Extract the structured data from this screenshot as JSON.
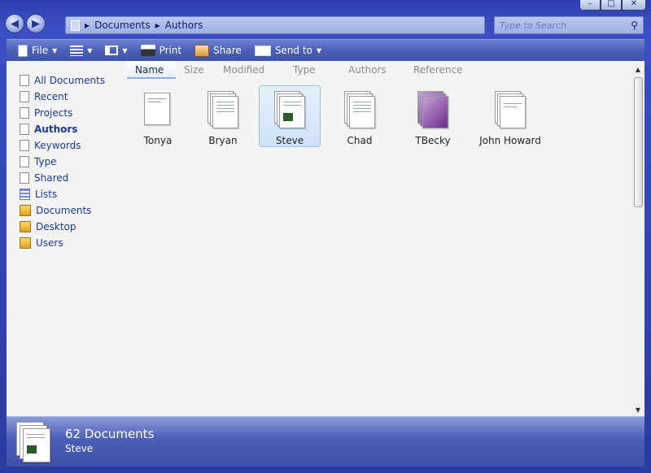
{
  "window": {
    "controls": [
      "–",
      "□",
      "✕"
    ]
  },
  "address": {
    "crumbs": [
      "Documents",
      "Authors"
    ]
  },
  "search": {
    "placeholder": "Type to Search"
  },
  "toolbar": {
    "file": "File",
    "print": "Print",
    "share": "Share",
    "send_to": "Send to"
  },
  "nav": {
    "items": [
      {
        "label": "All Documents",
        "icon": "document-icon"
      },
      {
        "label": "Recent",
        "icon": "document-icon"
      },
      {
        "label": "Projects",
        "icon": "document-icon"
      },
      {
        "label": "Authors",
        "icon": "document-icon"
      },
      {
        "label": "Keywords",
        "icon": "document-icon"
      },
      {
        "label": "Type",
        "icon": "document-icon"
      },
      {
        "label": "Shared",
        "icon": "document-icon"
      },
      {
        "label": "Lists",
        "icon": "list-icon"
      },
      {
        "label": "Documents",
        "icon": "folder-icon"
      },
      {
        "label": "Desktop",
        "icon": "folder-icon"
      },
      {
        "label": "Users",
        "icon": "folder-icon"
      }
    ],
    "active": "Authors"
  },
  "columns": [
    "Name",
    "Size",
    "Modified",
    "Type",
    "Authors",
    "Reference"
  ],
  "files": [
    {
      "label": "Tonya"
    },
    {
      "label": "Bryan"
    },
    {
      "label": "Steve"
    },
    {
      "label": "Chad"
    },
    {
      "label": "TBecky"
    },
    {
      "label": "John Howard"
    }
  ],
  "selected_file": "Steve",
  "details": {
    "count": "62 Documents",
    "name": "Steve"
  }
}
